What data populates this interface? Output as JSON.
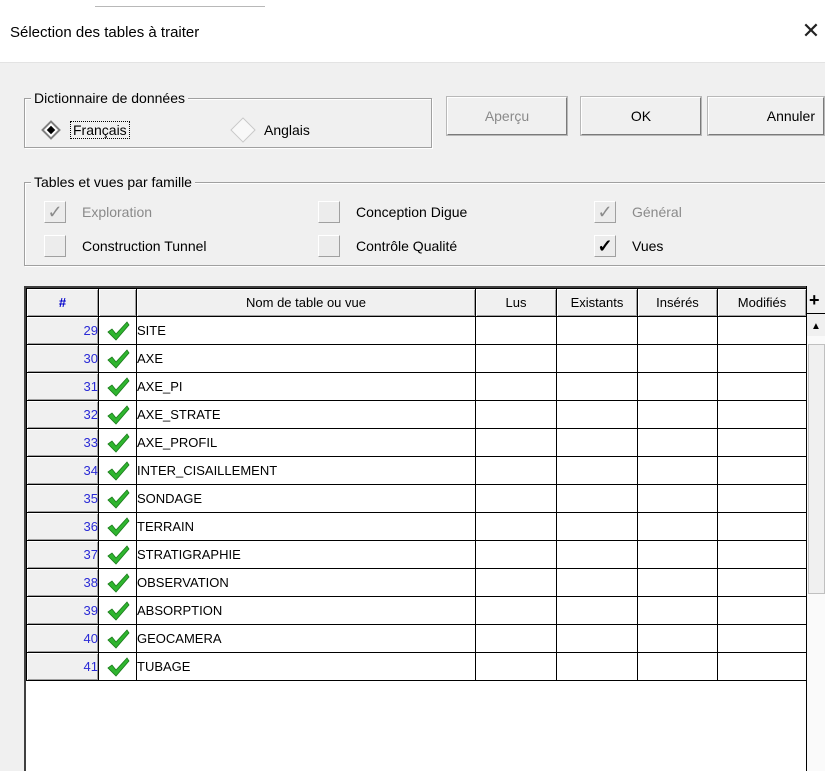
{
  "window": {
    "title": "Sélection des tables à traiter",
    "close_glyph": "✕"
  },
  "dictionary": {
    "label": "Dictionnaire de données",
    "options": [
      {
        "label": "Français",
        "selected": true
      },
      {
        "label": "Anglais",
        "selected": false
      }
    ]
  },
  "buttons": {
    "apercu": "Aperçu",
    "ok": "OK",
    "annuler": "Annuler"
  },
  "families": {
    "label": "Tables et vues par famille",
    "items": [
      {
        "label": "Exploration",
        "checked": true,
        "enabled": false
      },
      {
        "label": "Conception Digue",
        "checked": false,
        "enabled": true
      },
      {
        "label": "Général",
        "checked": true,
        "enabled": false
      },
      {
        "label": "Construction Tunnel",
        "checked": false,
        "enabled": true
      },
      {
        "label": "Contrôle Qualité",
        "checked": false,
        "enabled": true
      },
      {
        "label": "Vues",
        "checked": true,
        "enabled": true
      }
    ]
  },
  "grid": {
    "columns": [
      "#",
      "",
      "Nom de table ou vue",
      "Lus",
      "Existants",
      "Insérés",
      "Modifiés"
    ],
    "rows": [
      {
        "num": "29",
        "name": "SITE",
        "status": "check"
      },
      {
        "num": "30",
        "name": "AXE",
        "status": "check"
      },
      {
        "num": "31",
        "name": "AXE_PI",
        "status": "check"
      },
      {
        "num": "32",
        "name": "AXE_STRATE",
        "status": "check"
      },
      {
        "num": "33",
        "name": "AXE_PROFIL",
        "status": "check"
      },
      {
        "num": "34",
        "name": "INTER_CISAILLEMENT",
        "status": "check"
      },
      {
        "num": "35",
        "name": "SONDAGE",
        "status": "check"
      },
      {
        "num": "36",
        "name": "TERRAIN",
        "status": "check"
      },
      {
        "num": "37",
        "name": "STRATIGRAPHIE",
        "status": "check"
      },
      {
        "num": "38",
        "name": "OBSERVATION",
        "status": "check"
      },
      {
        "num": "39",
        "name": "ABSORPTION",
        "status": "check"
      },
      {
        "num": "40",
        "name": "GEOCAMERA",
        "status": "check"
      },
      {
        "num": "41",
        "name": "TUBAGE",
        "status": "check"
      }
    ]
  },
  "scrollbar": {
    "plus_glyph": "+",
    "up_glyph": "▲"
  },
  "colors": {
    "check_green": "#2fb52f",
    "row_number_blue": "#2a2ad6"
  }
}
